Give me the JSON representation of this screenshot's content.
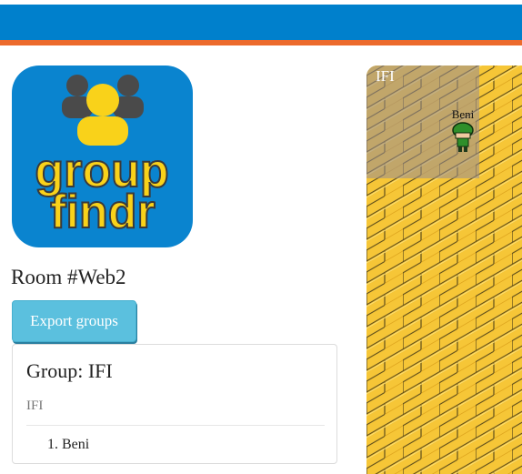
{
  "logo": {
    "line1": "group",
    "line2": "findr"
  },
  "room": {
    "title": "Room #Web2"
  },
  "toolbar": {
    "export_label": "Export groups"
  },
  "group": {
    "heading": "Group: IFI",
    "subtitle": "IFI",
    "members": [
      "1. Beni"
    ]
  },
  "map": {
    "zone_name": "IFI",
    "player_name": "Beni"
  },
  "colors": {
    "header_blue": "#0080cc",
    "header_orange": "#ec6a2c",
    "logo_bg": "#0a84cf",
    "logo_text": "#f9d21a",
    "button_bg": "#5bc0de",
    "floor": "#f6c637"
  },
  "icons": [
    "people-group-icon",
    "player-avatar-icon"
  ]
}
